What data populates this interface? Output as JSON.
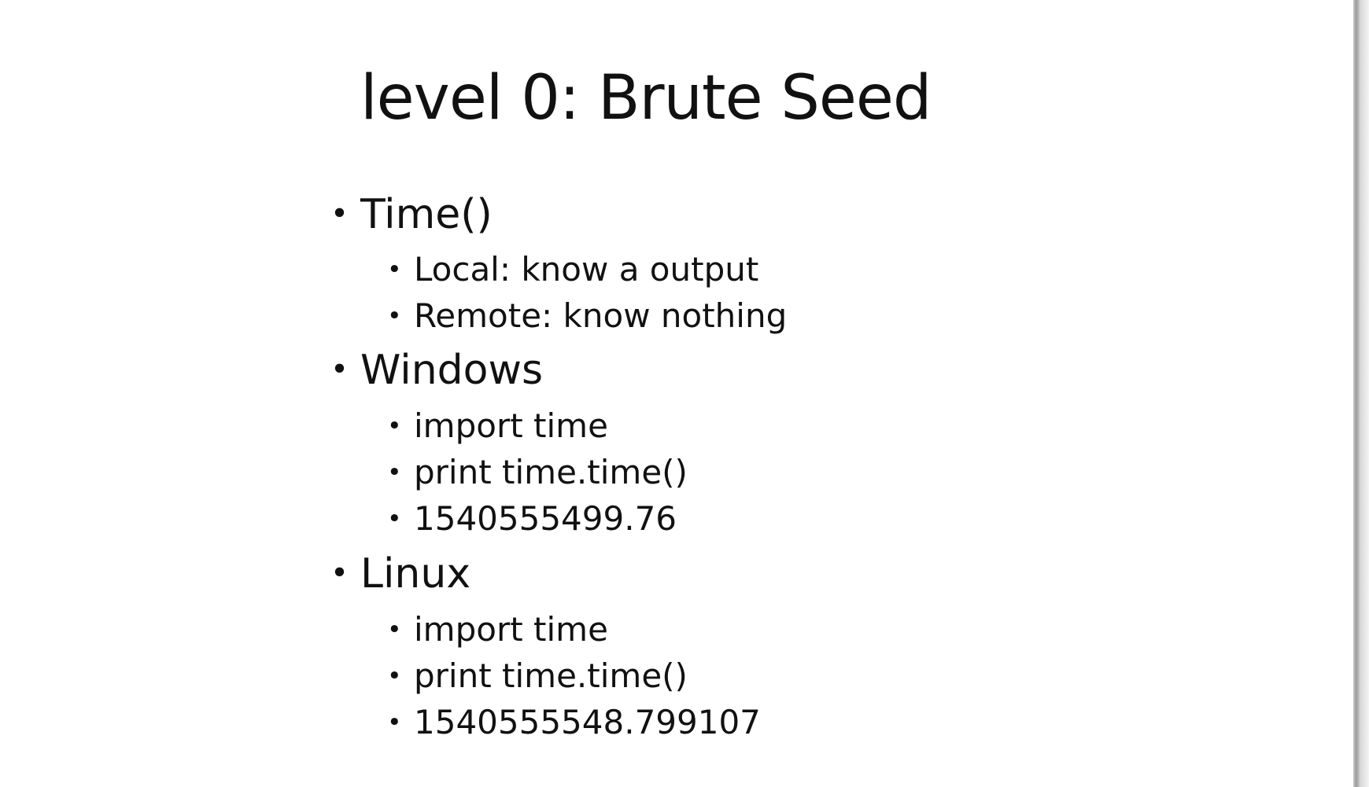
{
  "slide": {
    "title": "level 0: Brute Seed",
    "bullet_glyph": "•",
    "sections": [
      {
        "label": "Time()",
        "items": [
          "Local: know a output",
          "Remote: know nothing"
        ]
      },
      {
        "label": "Windows",
        "items": [
          "import time",
          "print time.time()",
          "1540555499.76"
        ]
      },
      {
        "label": "Linux",
        "items": [
          "import time",
          "print time.time()",
          "1540555548.799107"
        ]
      }
    ]
  }
}
